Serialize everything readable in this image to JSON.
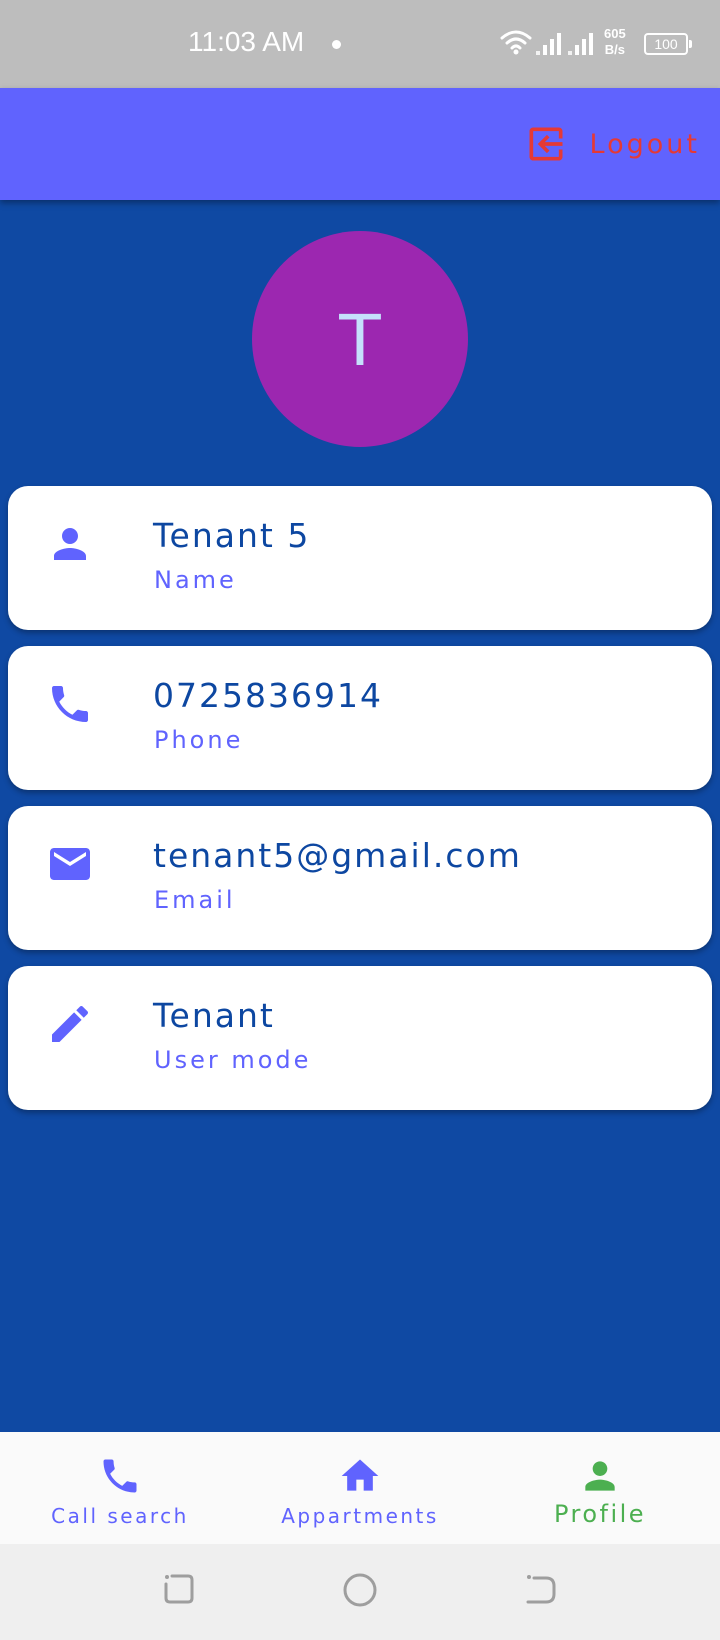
{
  "status_bar": {
    "time": "11:03 AM",
    "net_speed_value": "605",
    "net_speed_unit": "B/s",
    "battery": "100"
  },
  "app_bar": {
    "logout_label": "Logout",
    "logout_color": "#e53935",
    "background_color": "#6063fe"
  },
  "profile": {
    "avatar_letter": "T",
    "avatar_color": "#9c27b0",
    "fields": [
      {
        "icon": "person-icon",
        "value": "Tenant 5",
        "label": "Name"
      },
      {
        "icon": "phone-icon",
        "value": "0725836914",
        "label": "Phone"
      },
      {
        "icon": "email-icon",
        "value": "tenant5@gmail.com",
        "label": "Email"
      },
      {
        "icon": "pencil-icon",
        "value": "Tenant",
        "label": "User mode"
      }
    ]
  },
  "bottom_nav": {
    "items": [
      {
        "icon": "phone-icon",
        "label": "Call search",
        "active": false
      },
      {
        "icon": "home-icon",
        "label": "Appartments",
        "active": false
      },
      {
        "icon": "person-icon",
        "label": "Profile",
        "active": true
      }
    ],
    "active_color": "#4caf50",
    "inactive_color": "#6063fe"
  },
  "colors": {
    "page_background": "#0f49a3",
    "value_text": "#0d47a1",
    "label_text": "#6063fe"
  }
}
